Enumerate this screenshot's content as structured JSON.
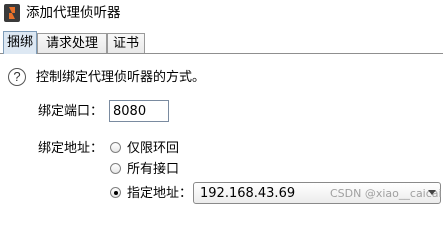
{
  "window": {
    "title": "添加代理侦听器",
    "icon": "burp-logo-icon",
    "accent_color": "#e8712a"
  },
  "tabs": [
    {
      "label": "捆绑",
      "active": true
    },
    {
      "label": "请求处理",
      "active": false
    },
    {
      "label": "证书",
      "active": false
    }
  ],
  "binding": {
    "help_icon": "question-circle-icon",
    "description": "控制绑定代理侦听器的方式。",
    "port_label": "绑定端口：",
    "port_value": "8080",
    "address_label": "绑定地址：",
    "address_options": [
      {
        "label": "仅限环回",
        "checked": false
      },
      {
        "label": "所有接口",
        "checked": false
      },
      {
        "label": "指定地址：",
        "checked": true
      }
    ],
    "specific_address_value": "192.168.43.69",
    "watermark": "CSDN @xiao__caicai"
  }
}
